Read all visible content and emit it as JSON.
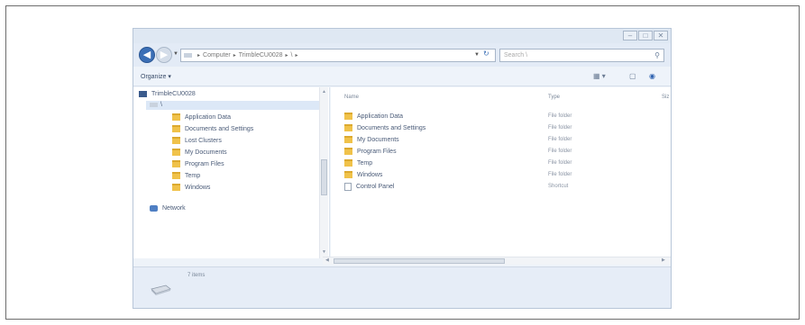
{
  "window": {
    "controls": [
      "–",
      "□",
      "✕"
    ]
  },
  "navbar": {
    "breadcrumbs": [
      "Computer",
      "TrimbleCU0028",
      "\\"
    ],
    "search_placeholder": "Search \\"
  },
  "toolbar": {
    "organize_label": "Organize ▾"
  },
  "navpane": {
    "computer_label": "TrimbleCU0028",
    "root_label": "\\",
    "folders": [
      "Application Data",
      "Documents and Settings",
      "Lost Clusters",
      "My Documents",
      "Program Files",
      "Temp",
      "Windows"
    ],
    "network_label": "Network"
  },
  "content": {
    "columns": [
      "Name",
      "Type",
      "Siz"
    ],
    "files": [
      {
        "name": "Application Data",
        "type": "File folder",
        "icon": "folder-icon"
      },
      {
        "name": "Documents and Settings",
        "type": "File folder",
        "icon": "folder-icon"
      },
      {
        "name": "My Documents",
        "type": "File folder",
        "icon": "folder-icon"
      },
      {
        "name": "Program Files",
        "type": "File folder",
        "icon": "folder-icon"
      },
      {
        "name": "Temp",
        "type": "File folder",
        "icon": "folder-icon"
      },
      {
        "name": "Windows",
        "type": "File folder",
        "icon": "folder-icon"
      },
      {
        "name": "Control Panel",
        "type": "Shortcut",
        "icon": "shortcut-icon"
      }
    ]
  },
  "details": {
    "count": "7 items"
  }
}
